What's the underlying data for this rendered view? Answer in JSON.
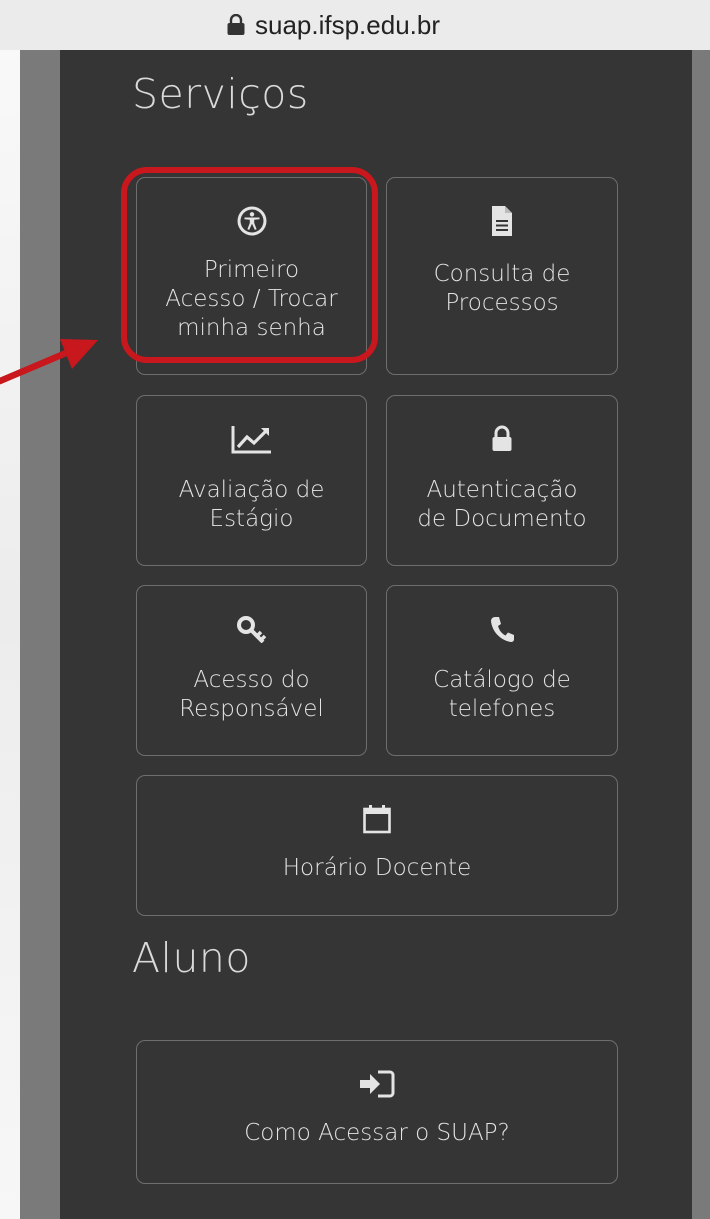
{
  "browser": {
    "url": "suap.ifsp.edu.br",
    "lock_icon": "lock-icon"
  },
  "sections": {
    "servicos_title": "Serviços",
    "aluno_title": "Aluno"
  },
  "tiles": [
    {
      "label": "Primeiro\nAcesso / Trocar\nminha senha",
      "icon": "accessibility-icon"
    },
    {
      "label": "Consulta de\nProcessos",
      "icon": "document-icon"
    },
    {
      "label": "Avaliação de\nEstágio",
      "icon": "line-chart-icon"
    },
    {
      "label": "Autenticação\nde Documento",
      "icon": "lock-icon"
    },
    {
      "label": "Acesso do\nResponsável",
      "icon": "key-icon"
    },
    {
      "label": "Catálogo de\ntelefones",
      "icon": "phone-icon"
    },
    {
      "label": "Horário Docente",
      "icon": "calendar-icon"
    },
    {
      "label": "Como Acessar o SUAP?",
      "icon": "sign-in-icon"
    }
  ],
  "colors": {
    "panel_background": "#353535",
    "tile_border": "#6e6e6e",
    "highlight": "#c8171d",
    "text": "#e4e4e4"
  }
}
